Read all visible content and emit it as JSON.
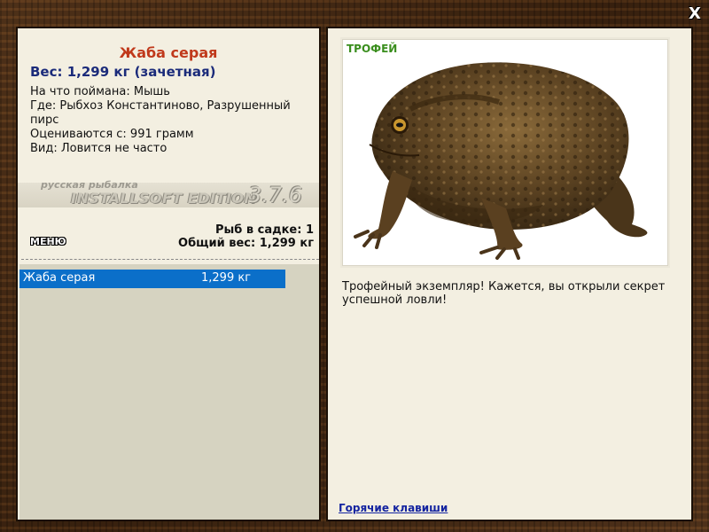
{
  "window": {
    "close_label": "X"
  },
  "fish": {
    "title": "Жаба серая",
    "weight": "Вес: 1,299 кг (зачетная)",
    "bait": "На что поймана: Мышь",
    "location": "Где: Рыбхоз Константиново, Разрушенный пирс",
    "valued": "Оцениваются с: 991 грамм",
    "rarity": "Вид: Ловится не часто"
  },
  "branding": {
    "small": "русская рыбалка",
    "main": "INSTALLSOFT EDITION",
    "version": "3.7.6"
  },
  "keepnet": {
    "menu_label": "МЕНЮ",
    "count": "Рыб в садке: 1",
    "total": "Общий вес: 1,299 кг",
    "items": [
      {
        "name": "Жаба серая",
        "weight": "1,299 кг"
      }
    ]
  },
  "trophy": {
    "label": "ТРОФЕЙ",
    "description": "Трофейный экземпляр! Кажется, вы открыли секрет успешной ловли!",
    "hotkeys_link": "Горячие клавиши"
  },
  "colors": {
    "title": "#c0391b",
    "weight": "#1b2b7a",
    "selection": "#0b6fc9",
    "trophy_label": "#3a8e1e",
    "link": "#1424a0"
  }
}
